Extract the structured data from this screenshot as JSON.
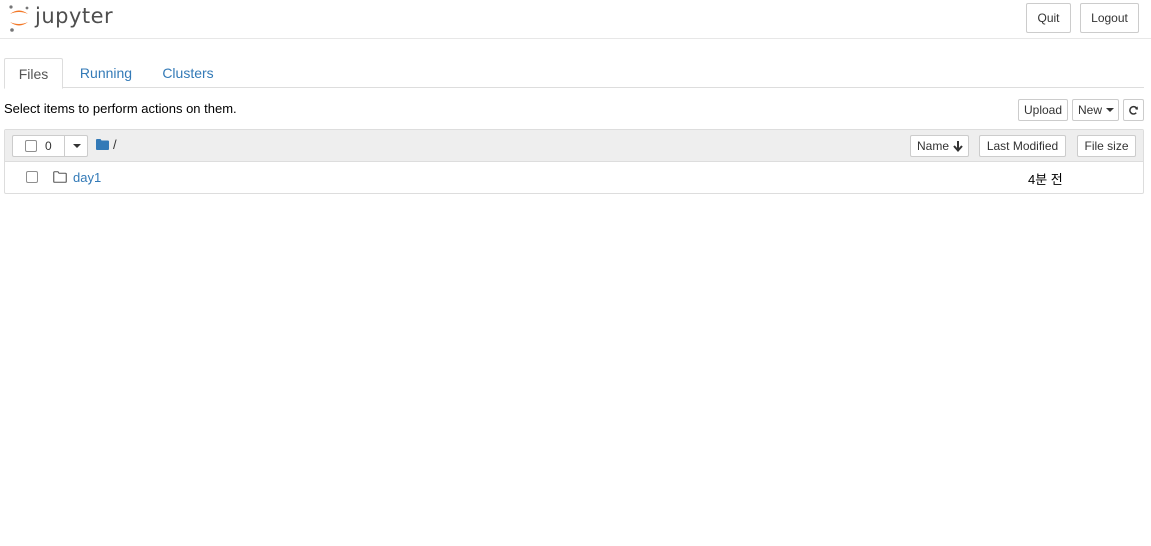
{
  "header": {
    "logo_text": "jupyter",
    "quit_label": "Quit",
    "logout_label": "Logout"
  },
  "tabs": [
    {
      "label": "Files",
      "active": true
    },
    {
      "label": "Running",
      "active": false
    },
    {
      "label": "Clusters",
      "active": false
    }
  ],
  "toolbar": {
    "instructions": "Select items to perform actions on them.",
    "upload_label": "Upload",
    "new_label": "New",
    "refresh_icon": "refresh-icon"
  },
  "list": {
    "selected_count": "0",
    "breadcrumb": "/",
    "columns": {
      "name": "Name",
      "last_modified": "Last Modified",
      "file_size": "File size"
    },
    "items": [
      {
        "name": "day1",
        "type": "folder",
        "modified": "4분 전",
        "size": ""
      }
    ]
  },
  "colors": {
    "link": "#337ab7",
    "logo_orange": "#f37726",
    "header_bg": "#eeeeee"
  }
}
